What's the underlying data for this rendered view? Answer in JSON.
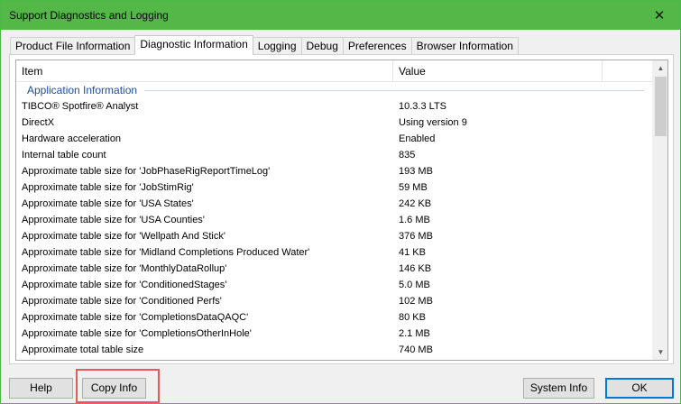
{
  "window": {
    "title": "Support Diagnostics and Logging",
    "close_glyph": "✕"
  },
  "tabs": [
    {
      "label": "Product File Information",
      "active": false
    },
    {
      "label": "Diagnostic Information",
      "active": true
    },
    {
      "label": "Logging",
      "active": false
    },
    {
      "label": "Debug",
      "active": false
    },
    {
      "label": "Preferences",
      "active": false
    },
    {
      "label": "Browser Information",
      "active": false
    }
  ],
  "grid": {
    "columns": {
      "item": "Item",
      "value": "Value"
    },
    "group": "Application Information",
    "rows": [
      {
        "item": "TIBCO® Spotfire® Analyst",
        "value": "10.3.3 LTS"
      },
      {
        "item": "DirectX",
        "value": "Using version 9"
      },
      {
        "item": "Hardware acceleration",
        "value": "Enabled"
      },
      {
        "item": "Internal table count",
        "value": "835"
      },
      {
        "item": "Approximate table size for 'JobPhaseRigReportTimeLog'",
        "value": "193 MB"
      },
      {
        "item": "Approximate table size for 'JobStimRig'",
        "value": "59 MB"
      },
      {
        "item": "Approximate table size for 'USA States'",
        "value": "242 KB"
      },
      {
        "item": "Approximate table size for 'USA Counties'",
        "value": "1.6 MB"
      },
      {
        "item": "Approximate table size for 'Wellpath And Stick'",
        "value": "376 MB"
      },
      {
        "item": "Approximate table size for 'Midland Completions Produced Water'",
        "value": "41 KB"
      },
      {
        "item": "Approximate table size for 'MonthlyDataRollup'",
        "value": "146 KB"
      },
      {
        "item": "Approximate table size for 'ConditionedStages'",
        "value": "5.0 MB"
      },
      {
        "item": "Approximate table size for 'Conditioned Perfs'",
        "value": "102 MB"
      },
      {
        "item": "Approximate table size for 'CompletionsDataQAQC'",
        "value": "80 KB"
      },
      {
        "item": "Approximate table size for 'CompletionsOtherInHole'",
        "value": "2.1 MB"
      },
      {
        "item": "Approximate total table size",
        "value": "740 MB"
      }
    ]
  },
  "buttons": {
    "help": "Help",
    "copy_info": "Copy Info",
    "system_info": "System Info",
    "ok": "OK"
  },
  "colors": {
    "titlebar": "#53b847",
    "group_label": "#1a4fa0",
    "highlight": "#e35a5a",
    "ok_border": "#0078d7"
  }
}
